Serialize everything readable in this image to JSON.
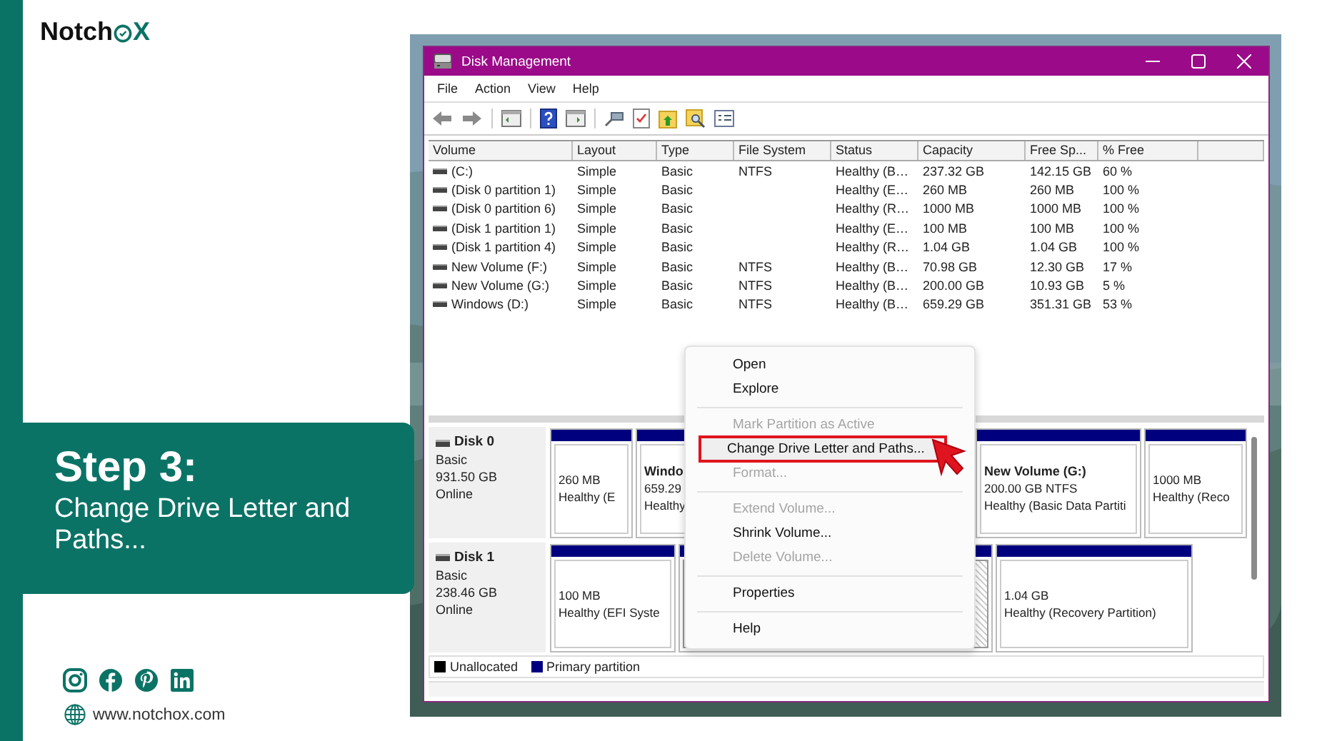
{
  "brand": {
    "prefix": "Notch",
    "suffix": "X"
  },
  "banner": {
    "title": "Step 3:",
    "subtitle": "Change Drive Letter and Paths..."
  },
  "social": [
    {
      "kind": "instagram"
    },
    {
      "kind": "facebook"
    },
    {
      "kind": "pinterest"
    },
    {
      "kind": "linkedin"
    }
  ],
  "website": "www.notchox.com",
  "window": {
    "title": "Disk Management",
    "menu": [
      "File",
      "Action",
      "View",
      "Help"
    ],
    "toolbar": [
      {
        "kind": "back"
      },
      {
        "kind": "forward"
      },
      {
        "kind": "sep"
      },
      {
        "kind": "console"
      },
      {
        "kind": "sep"
      },
      {
        "kind": "help"
      },
      {
        "kind": "panel"
      },
      {
        "kind": "sep"
      },
      {
        "kind": "connect"
      },
      {
        "kind": "check"
      },
      {
        "kind": "folder-up"
      },
      {
        "kind": "folder-search"
      },
      {
        "kind": "list"
      }
    ],
    "table": {
      "columns": [
        "Volume",
        "Layout",
        "Type",
        "File System",
        "Status",
        "Capacity",
        "Free Sp...",
        "% Free"
      ],
      "rows": [
        [
          "(C:)",
          "Simple",
          "Basic",
          "NTFS",
          "Healthy (B…",
          "237.32 GB",
          "142.15 GB",
          "60 %"
        ],
        [
          "(Disk 0 partition 1)",
          "Simple",
          "Basic",
          "",
          "Healthy (E…",
          "260 MB",
          "260 MB",
          "100 %"
        ],
        [
          "(Disk 0 partition 6)",
          "Simple",
          "Basic",
          "",
          "Healthy (R…",
          "1000 MB",
          "1000 MB",
          "100 %"
        ],
        [
          "(Disk 1 partition 1)",
          "Simple",
          "Basic",
          "",
          "Healthy (E…",
          "100 MB",
          "100 MB",
          "100 %"
        ],
        [
          "(Disk 1 partition 4)",
          "Simple",
          "Basic",
          "",
          "Healthy (R…",
          "1.04 GB",
          "1.04 GB",
          "100 %"
        ],
        [
          "New Volume (F:)",
          "Simple",
          "Basic",
          "NTFS",
          "Healthy (B…",
          "70.98 GB",
          "12.30 GB",
          "17 %"
        ],
        [
          "New Volume (G:)",
          "Simple",
          "Basic",
          "NTFS",
          "Healthy (B…",
          "200.00 GB",
          "10.93 GB",
          "5 %"
        ],
        [
          "Windows (D:)",
          "Simple",
          "Basic",
          "NTFS",
          "Healthy (B…",
          "659.29 GB",
          "351.31 GB",
          "53 %"
        ]
      ]
    },
    "disks": [
      {
        "name": "Disk 0",
        "type": "Basic",
        "size": "931.50 GB",
        "status": "Online",
        "partitions": [
          {
            "lines": [
              "260 MB",
              "Healthy (E"
            ],
            "selected": false
          },
          {
            "name": "Windo",
            "lines": [
              "659.29",
              "Healthy"
            ],
            "selected": false
          },
          {
            "name": "New Volume  (G:)",
            "lines": [
              "200.00 GB NTFS",
              "Healthy (Basic Data Partiti"
            ],
            "selected": false
          },
          {
            "lines": [
              "1000 MB",
              "Healthy (Reco"
            ],
            "selected": false
          }
        ]
      },
      {
        "name": "Disk 1",
        "type": "Basic",
        "size": "238.46 GB",
        "status": "Online",
        "partitions": [
          {
            "lines": [
              "100 MB",
              "Healthy (EFI Syste"
            ],
            "selected": false
          },
          {
            "selected": true
          },
          {
            "lines": [
              "1.04 GB",
              "Healthy (Recovery Partition)"
            ],
            "selected": false
          }
        ]
      }
    ],
    "legend": [
      {
        "label": "Unallocated",
        "color": "#000000"
      },
      {
        "label": "Primary partition",
        "color": "#00007f"
      }
    ],
    "context_menu": [
      {
        "kind": "item",
        "label": "Open",
        "disabled": false,
        "selected": false
      },
      {
        "kind": "item",
        "label": "Explore",
        "disabled": false,
        "selected": false
      },
      {
        "kind": "separator"
      },
      {
        "kind": "item",
        "label": "Mark Partition as Active",
        "disabled": true,
        "selected": false
      },
      {
        "kind": "item",
        "label": "Change Drive Letter and Paths...",
        "disabled": false,
        "selected": true
      },
      {
        "kind": "item",
        "label": "Format...",
        "disabled": true,
        "selected": false
      },
      {
        "kind": "separator"
      },
      {
        "kind": "item",
        "label": "Extend Volume...",
        "disabled": true,
        "selected": false
      },
      {
        "kind": "item",
        "label": "Shrink Volume...",
        "disabled": false,
        "selected": false
      },
      {
        "kind": "item",
        "label": "Delete Volume...",
        "disabled": true,
        "selected": false
      },
      {
        "kind": "separator"
      },
      {
        "kind": "item",
        "label": "Properties",
        "disabled": false,
        "selected": false
      },
      {
        "kind": "separator"
      },
      {
        "kind": "item",
        "label": "Help",
        "disabled": false,
        "selected": false
      }
    ]
  }
}
